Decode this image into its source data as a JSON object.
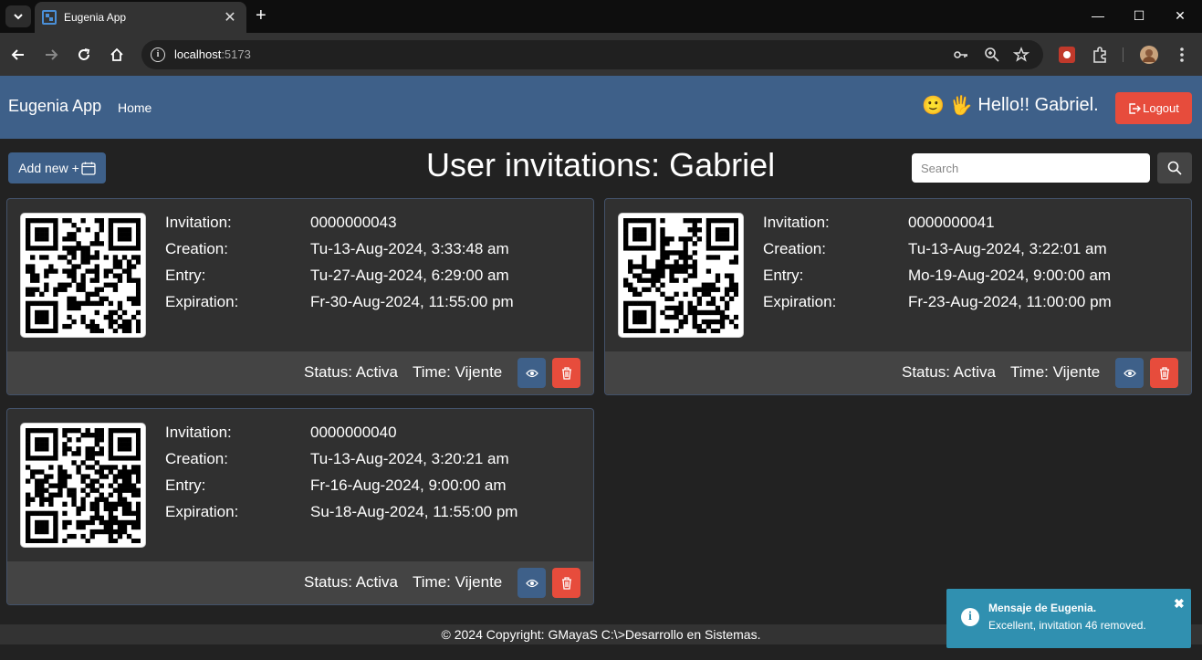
{
  "browser": {
    "tab_title": "Eugenia App",
    "tab_close": "✕",
    "new_tab": "+",
    "url_host": "localhost",
    "url_port": ":5173",
    "window_controls": [
      "—",
      "☐",
      "✕"
    ]
  },
  "navbar": {
    "brand": "Eugenia App",
    "home_label": "Home",
    "greeting_emojis": "🙂 🖐",
    "greeting": "Hello!! Gabriel.",
    "logout_label": "Logout",
    "background_color": "#3e6089"
  },
  "header": {
    "add_new_label": "Add new +",
    "title": "User invitations: Gabriel",
    "search_placeholder": "Search"
  },
  "labels": {
    "invitation": "Invitation:",
    "creation": "Creation:",
    "entry": "Entry:",
    "expiration": "Expiration:"
  },
  "cards": [
    {
      "invitation": "0000000043",
      "creation": "Tu-13-Aug-2024, 3:33:48 am",
      "entry": "Tu-27-Aug-2024, 6:29:00 am",
      "expiration": "Fr-30-Aug-2024, 11:55:00 pm",
      "status": "Status: Activa",
      "time": "Time: Vijente"
    },
    {
      "invitation": "0000000041",
      "creation": "Tu-13-Aug-2024, 3:22:01 am",
      "entry": "Mo-19-Aug-2024, 9:00:00 am",
      "expiration": "Fr-23-Aug-2024, 11:00:00 pm",
      "status": "Status: Activa",
      "time": "Time: Vijente"
    },
    {
      "invitation": "0000000040",
      "creation": "Tu-13-Aug-2024, 3:20:21 am",
      "entry": "Fr-16-Aug-2024, 9:00:00 am",
      "expiration": "Su-18-Aug-2024, 11:55:00 pm",
      "status": "Status: Activa",
      "time": "Time: Vijente"
    }
  ],
  "footer": {
    "copyright": "© 2024 Copyright: GMayaS C:\\>Desarrollo en Sistemas."
  },
  "toast": {
    "title": "Mensaje de Eugenia.",
    "message": "Excellent, invitation 46 removed.",
    "close": "✖",
    "color": "#3090b0"
  }
}
